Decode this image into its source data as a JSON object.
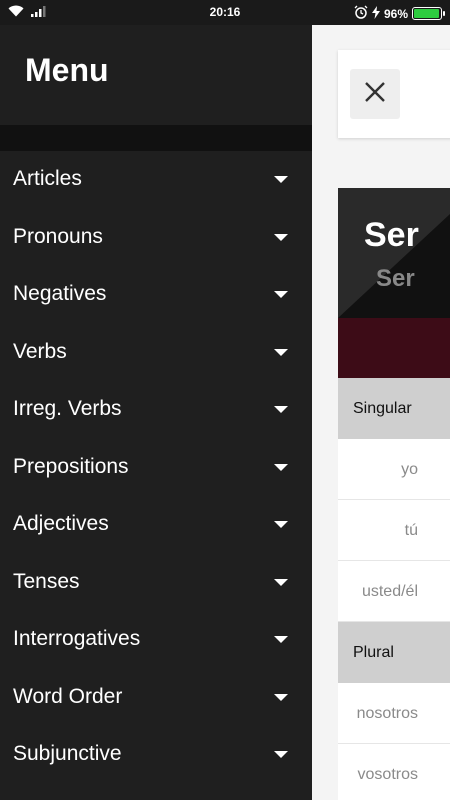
{
  "status_bar": {
    "time": "20:16",
    "battery_percent": "96%",
    "battery_level": 0.96,
    "icons": [
      "wifi-icon",
      "signal-icon",
      "alarm-icon",
      "charging-icon",
      "battery-icon"
    ]
  },
  "drawer": {
    "title": "Menu",
    "items": [
      {
        "label": "Articles"
      },
      {
        "label": "Pronouns"
      },
      {
        "label": "Negatives"
      },
      {
        "label": "Verbs"
      },
      {
        "label": "Irreg. Verbs"
      },
      {
        "label": "Prepositions"
      },
      {
        "label": "Adjectives"
      },
      {
        "label": "Tenses"
      },
      {
        "label": "Interrogatives"
      },
      {
        "label": "Word Order"
      },
      {
        "label": "Subjunctive"
      }
    ]
  },
  "content": {
    "verb_title": "Ser",
    "verb_subtitle": "Ser",
    "rows": [
      {
        "type": "section",
        "label": "Singular"
      },
      {
        "type": "pronoun",
        "label": "yo"
      },
      {
        "type": "pronoun",
        "label": "tú"
      },
      {
        "type": "pronoun",
        "label": "usted/él"
      },
      {
        "type": "section",
        "label": "Plural"
      },
      {
        "type": "pronoun",
        "label": "nosotros"
      },
      {
        "type": "pronoun",
        "label": "vosotros"
      }
    ]
  },
  "colors": {
    "drawer_bg": "#1f1f1f",
    "maroon": "#3d0c17",
    "battery_green": "#2ecc40"
  }
}
